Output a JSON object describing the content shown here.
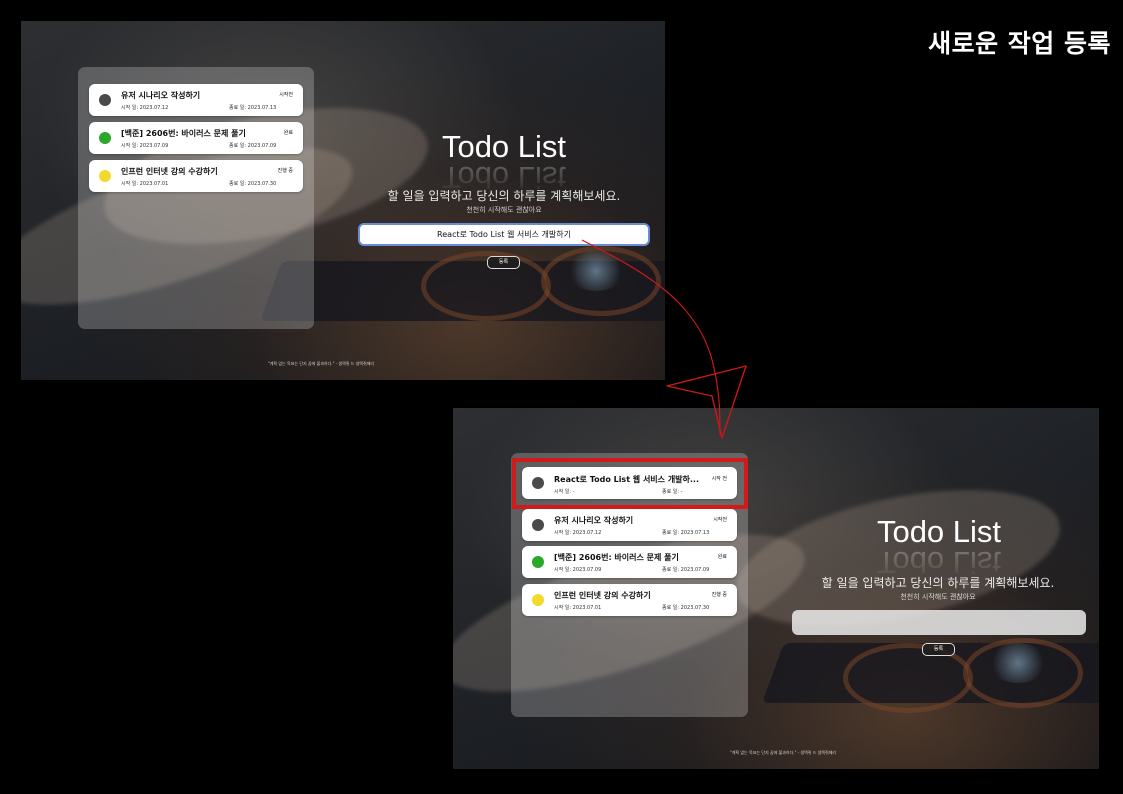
{
  "page_heading": "새로운 작업 등록",
  "colors": {
    "status_todo": "#4a4a4a",
    "status_done": "#2aa82a",
    "status_doing": "#f2d92c",
    "highlight": "#d11a1a"
  },
  "before": {
    "app_title": "Todo List",
    "subtitle": "할 일을 입력하고 당신의 하루를 계획해보세요.",
    "subsubtitle": "천천히 시작해도 괜찮아요",
    "input_value": "React로 Todo List 웹 서비스 개발하기",
    "register_label": "등록",
    "quote": "\"계획 없는 목표는 단지 꿈에 불과하다.\" - 생텍쥐 드 생텍쥐페리",
    "tasks": [
      {
        "title": "유저 시나리오 작성하기",
        "status": "시작전",
        "start": "시작 일: 2023.07.12",
        "end": "종료 일: 2023.07.13"
      },
      {
        "title": "[백준] 2606번: 바이러스 문제 풀기",
        "status": "완료",
        "start": "시작 일: 2023.07.09",
        "end": "종료 일: 2023.07.09"
      },
      {
        "title": "인프런 인터넷 강의 수강하기",
        "status": "진행 중",
        "start": "시작 일: 2023.07.01",
        "end": "종료 일: 2023.07.30"
      }
    ]
  },
  "after": {
    "app_title": "Todo List",
    "subtitle": "할 일을 입력하고 당신의 하루를 계획해보세요.",
    "subsubtitle": "천천히 시작해도 괜찮아요",
    "input_value": "",
    "register_label": "등록",
    "quote": "\"계획 없는 목표는 단지 꿈에 불과하다.\" - 생텍쥐 드 생텍쥐페리",
    "tasks": [
      {
        "title": "React로 Todo List 웹 서비스 개발하...",
        "status": "시작 전",
        "start": "시작 일: -",
        "end": "종료 일: -"
      },
      {
        "title": "유저 시나리오 작성하기",
        "status": "시작전",
        "start": "시작 일: 2023.07.12",
        "end": "종료 일: 2023.07.13"
      },
      {
        "title": "[백준] 2606번: 바이러스 문제 풀기",
        "status": "완료",
        "start": "시작 일: 2023.07.09",
        "end": "종료 일: 2023.07.09"
      },
      {
        "title": "인프런 인터넷 강의 수강하기",
        "status": "진행 중",
        "start": "시작 일: 2023.07.01",
        "end": "종료 일: 2023.07.30"
      }
    ]
  }
}
